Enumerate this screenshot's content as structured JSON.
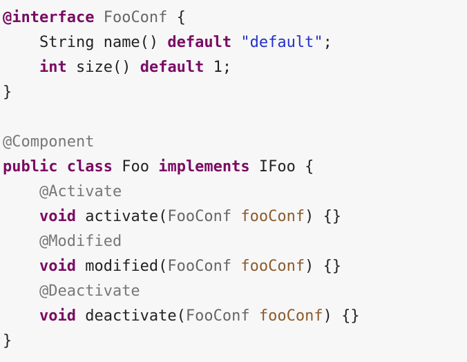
{
  "code": {
    "lines": [
      [
        {
          "text": "@interface",
          "role": "keyword"
        },
        {
          "text": " ",
          "role": "space"
        },
        {
          "text": "FooConf",
          "role": "type"
        },
        {
          "text": " {",
          "role": "plain"
        }
      ],
      [
        {
          "text": "    ",
          "role": "space"
        },
        {
          "text": "String name()",
          "role": "plain"
        },
        {
          "text": " ",
          "role": "space"
        },
        {
          "text": "default",
          "role": "keyword"
        },
        {
          "text": " ",
          "role": "space"
        },
        {
          "text": "\"default\"",
          "role": "string"
        },
        {
          "text": ";",
          "role": "plain"
        }
      ],
      [
        {
          "text": "    ",
          "role": "space"
        },
        {
          "text": "int",
          "role": "keyword"
        },
        {
          "text": " size()",
          "role": "plain"
        },
        {
          "text": " ",
          "role": "space"
        },
        {
          "text": "default",
          "role": "keyword"
        },
        {
          "text": " 1;",
          "role": "plain"
        }
      ],
      [
        {
          "text": "}",
          "role": "plain"
        }
      ],
      [],
      [
        {
          "text": "@Component",
          "role": "annotation"
        }
      ],
      [
        {
          "text": "public",
          "role": "keyword"
        },
        {
          "text": " ",
          "role": "space"
        },
        {
          "text": "class",
          "role": "keyword"
        },
        {
          "text": " Foo ",
          "role": "plain"
        },
        {
          "text": "implements",
          "role": "keyword"
        },
        {
          "text": " IFoo {",
          "role": "plain"
        }
      ],
      [
        {
          "text": "    ",
          "role": "space"
        },
        {
          "text": "@Activate",
          "role": "annotation"
        }
      ],
      [
        {
          "text": "    ",
          "role": "space"
        },
        {
          "text": "void",
          "role": "keyword"
        },
        {
          "text": " activate(",
          "role": "plain"
        },
        {
          "text": "FooConf",
          "role": "type"
        },
        {
          "text": " ",
          "role": "space"
        },
        {
          "text": "fooConf",
          "role": "param"
        },
        {
          "text": ") {}",
          "role": "plain"
        }
      ],
      [
        {
          "text": "    ",
          "role": "space"
        },
        {
          "text": "@Modified",
          "role": "annotation"
        }
      ],
      [
        {
          "text": "    ",
          "role": "space"
        },
        {
          "text": "void",
          "role": "keyword"
        },
        {
          "text": " modified(",
          "role": "plain"
        },
        {
          "text": "FooConf",
          "role": "type"
        },
        {
          "text": " ",
          "role": "space"
        },
        {
          "text": "fooConf",
          "role": "param"
        },
        {
          "text": ") {}",
          "role": "plain"
        }
      ],
      [
        {
          "text": "    ",
          "role": "space"
        },
        {
          "text": "@Deactivate",
          "role": "annotation"
        }
      ],
      [
        {
          "text": "    ",
          "role": "space"
        },
        {
          "text": "void",
          "role": "keyword"
        },
        {
          "text": " deactivate(",
          "role": "plain"
        },
        {
          "text": "FooConf",
          "role": "type"
        },
        {
          "text": " ",
          "role": "space"
        },
        {
          "text": "fooConf",
          "role": "param"
        },
        {
          "text": ") {}",
          "role": "plain"
        }
      ],
      [
        {
          "text": "}",
          "role": "plain"
        }
      ]
    ]
  },
  "colors": {
    "background": "#f7f7f7",
    "plain": "#222222",
    "keyword": "#7a0b63",
    "annotation": "#777777",
    "type": "#666666",
    "param": "#8b5a2b",
    "string": "#2230c8"
  }
}
